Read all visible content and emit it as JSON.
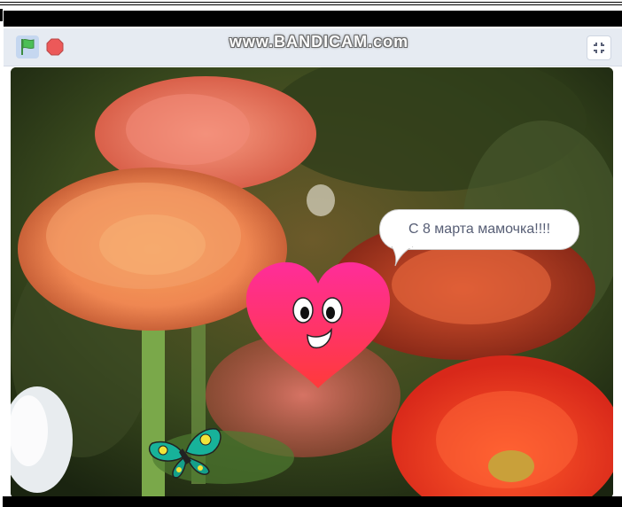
{
  "toolbar": {
    "watermark": "www.BANDICAM.com",
    "green_flag": "green-flag-icon",
    "stop": "stop-sign-icon",
    "fullscreen": "exit-fullscreen-icon"
  },
  "stage": {
    "speech": "С 8 марта мамочка!!!!",
    "sprites": [
      "heart-character",
      "butterfly"
    ]
  },
  "colors": {
    "toolbar_bg": "#e6ebf2",
    "flag_green": "#4cbf56",
    "stop_red": "#ec5959",
    "heart_top": "#ff2d9a",
    "heart_bottom": "#ff3a3a",
    "bubble_text": "#575e75"
  }
}
